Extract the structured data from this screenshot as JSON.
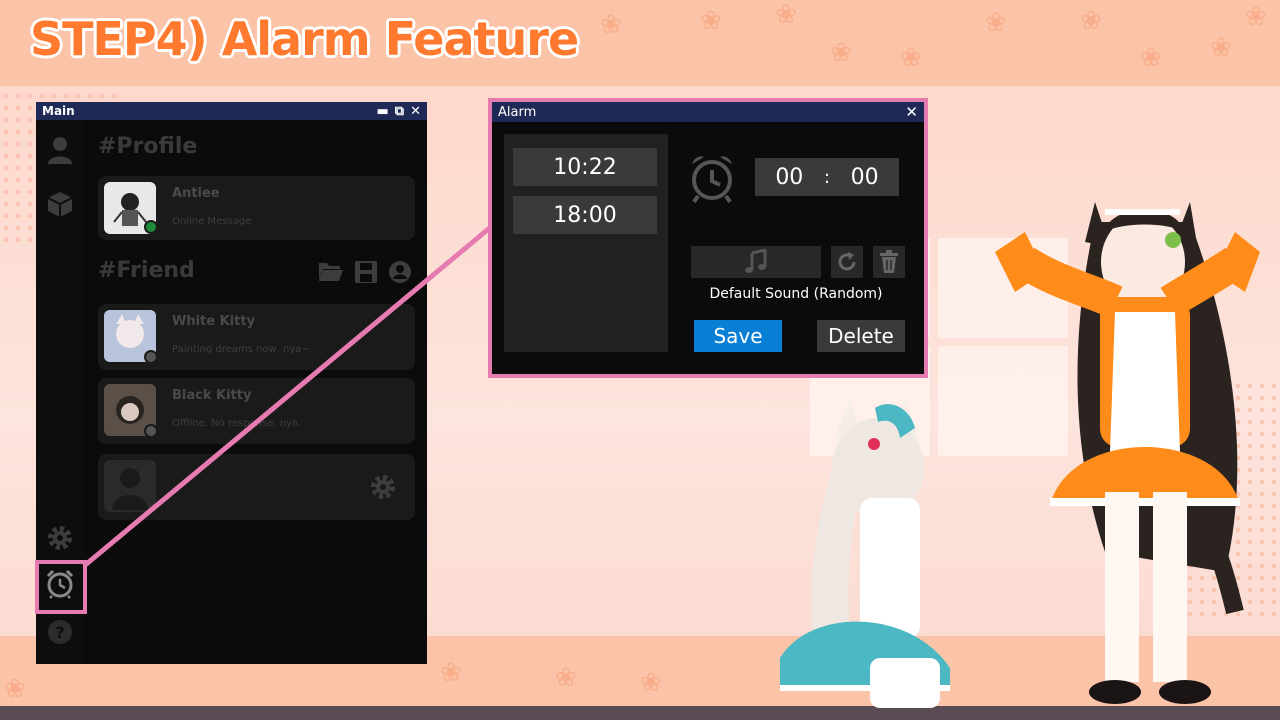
{
  "page": {
    "heading": "STEP4) Alarm Feature"
  },
  "main_window": {
    "title": "Main",
    "controls": {
      "minimize": "▬",
      "popout": "⧉",
      "close": "✕"
    },
    "profile": {
      "heading": "#Profile",
      "name": "Antiee",
      "message": "Online Message",
      "status_color": "#1f8b3a"
    },
    "friends": {
      "heading": "#Friend",
      "items": [
        {
          "name": "White Kitty",
          "message": "Painting dreams now, nya~",
          "status_color": "#555555"
        },
        {
          "name": "Black Kitty",
          "message": "Offline. No response, nya.",
          "status_color": "#555555"
        }
      ]
    },
    "sidebar_icons": [
      "user-icon",
      "package-icon",
      "gear-icon",
      "alarm-clock-icon",
      "help-icon"
    ]
  },
  "alarm_window": {
    "title": "Alarm",
    "close": "✕",
    "alarms": [
      "10:22",
      "18:00"
    ],
    "time_input": {
      "hours": "00",
      "separator": ":",
      "minutes": "00"
    },
    "sound_label": "Default Sound (Random)",
    "save_label": "Save",
    "delete_label": "Delete",
    "accent_color": "#0a7fd6"
  },
  "highlight_color": "#e57bb0"
}
